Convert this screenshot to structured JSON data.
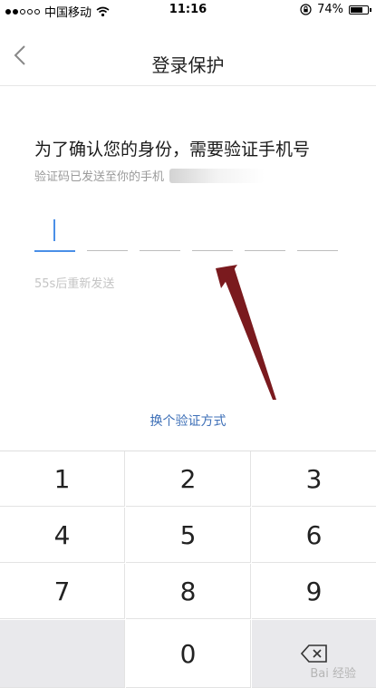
{
  "status_bar": {
    "carrier": "中国移动",
    "time": "11:16",
    "battery": "74%",
    "battery_level": 0.74
  },
  "nav": {
    "title": "登录保护"
  },
  "main": {
    "heading": "为了确认您的身份，需要验证手机号",
    "subline": "验证码已发送至你的手机",
    "resend": "55s后重新发送",
    "switch_link": "换个验证方式"
  },
  "keypad": {
    "keys": [
      "1",
      "2",
      "3",
      "4",
      "5",
      "6",
      "7",
      "8",
      "9",
      "0"
    ]
  },
  "watermark": "Bai 经验",
  "colors": {
    "accent": "#4a8fe7",
    "link": "#3d6fb7",
    "arrow": "#7a1a1e"
  }
}
